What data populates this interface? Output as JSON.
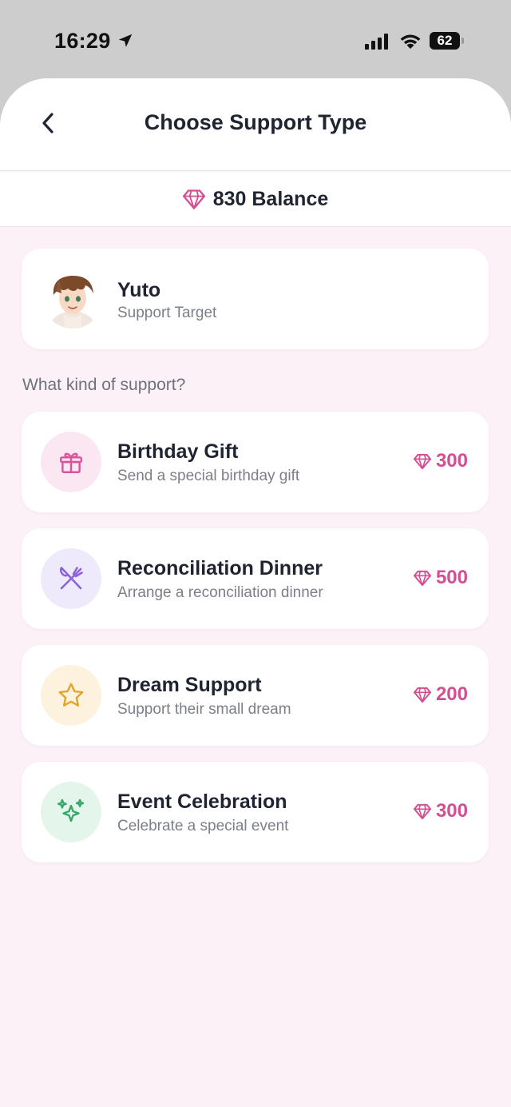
{
  "status_bar": {
    "time": "16:29",
    "battery": "62",
    "battery_fraction": 0.62
  },
  "header": {
    "title": "Choose Support Type"
  },
  "balance": {
    "text": "830 Balance"
  },
  "target": {
    "name": "Yuto",
    "subtitle": "Support Target"
  },
  "section": {
    "label": "What kind of support?"
  },
  "options": [
    {
      "title": "Birthday Gift",
      "description": "Send a special birthday gift",
      "price": "300",
      "icon": "gift-icon",
      "icon_bg": "#fbe7f1",
      "icon_color": "#d9559a"
    },
    {
      "title": "Reconciliation Dinner",
      "description": "Arrange a reconciliation dinner",
      "price": "500",
      "icon": "utensils-icon",
      "icon_bg": "#efe9fc",
      "icon_color": "#8b63d6"
    },
    {
      "title": "Dream Support",
      "description": "Support their small dream",
      "price": "200",
      "icon": "star-icon",
      "icon_bg": "#fdf2de",
      "icon_color": "#e0a52a"
    },
    {
      "title": "Event Celebration",
      "description": "Celebrate a special event",
      "price": "300",
      "icon": "sparkles-icon",
      "icon_bg": "#e4f6ec",
      "icon_color": "#3aa66a"
    }
  ],
  "colors": {
    "accent": "#d34f92",
    "background": "#fcf1f7"
  }
}
